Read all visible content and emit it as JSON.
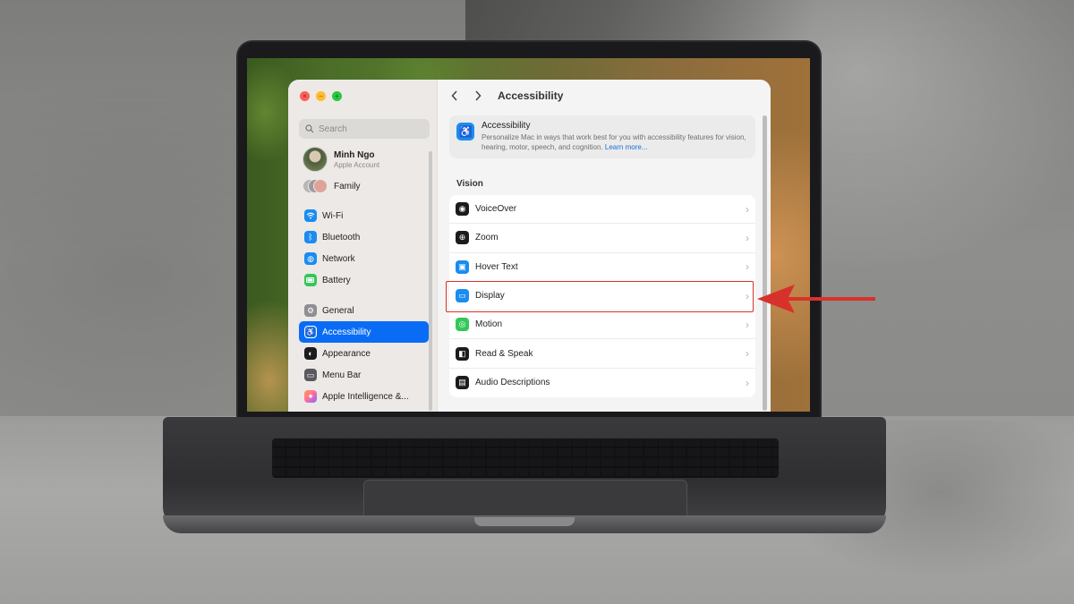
{
  "window": {
    "title": "Accessibility",
    "traffic_lights": [
      "close",
      "minimize",
      "zoom"
    ]
  },
  "sidebar": {
    "search_placeholder": "Search",
    "account": {
      "name": "Minh Ngo",
      "subtitle": "Apple Account"
    },
    "family_label": "Family",
    "items": [
      {
        "label": "Wi-Fi",
        "icon": "wifi-icon",
        "color": "#1a8cf0"
      },
      {
        "label": "Bluetooth",
        "icon": "bluetooth-icon",
        "color": "#1a8cf0"
      },
      {
        "label": "Network",
        "icon": "globe-icon",
        "color": "#1a8cf0"
      },
      {
        "label": "Battery",
        "icon": "battery-icon",
        "color": "#34c759"
      },
      {
        "label": "General",
        "icon": "gear-icon",
        "color": "#8e8e93"
      },
      {
        "label": "Accessibility",
        "icon": "accessibility-icon",
        "color": "#1a8cf0",
        "active": true
      },
      {
        "label": "Appearance",
        "icon": "appearance-icon",
        "color": "#1c1c1e"
      },
      {
        "label": "Menu Bar",
        "icon": "menu-bar-icon",
        "color": "#5a5a5e"
      },
      {
        "label": "Apple Intelligence &...",
        "icon": "apple-intelligence-icon",
        "color": "#ff6aa2"
      }
    ]
  },
  "main": {
    "hero": {
      "title": "Accessibility",
      "description": "Personalize Mac in ways that work best for you with accessibility features for vision, hearing, motor, speech, and cognition.",
      "link": "Learn more..."
    },
    "section_title": "Vision",
    "rows": [
      {
        "label": "VoiceOver",
        "icon": "voiceover-icon",
        "color": "#1c1c1e"
      },
      {
        "label": "Zoom",
        "icon": "zoom-icon",
        "color": "#1c1c1e"
      },
      {
        "label": "Hover Text",
        "icon": "hover-text-icon",
        "color": "#1a8cf0"
      },
      {
        "label": "Display",
        "icon": "display-icon",
        "color": "#1a8cf0",
        "highlighted": true
      },
      {
        "label": "Motion",
        "icon": "motion-icon",
        "color": "#34c759"
      },
      {
        "label": "Read & Speak",
        "icon": "read-speak-icon",
        "color": "#1c1c1e"
      },
      {
        "label": "Audio Descriptions",
        "icon": "audio-descriptions-icon",
        "color": "#1c1c1e"
      }
    ]
  },
  "annotation": {
    "highlight_color": "#d8312b",
    "arrow_color": "#d8312b"
  }
}
